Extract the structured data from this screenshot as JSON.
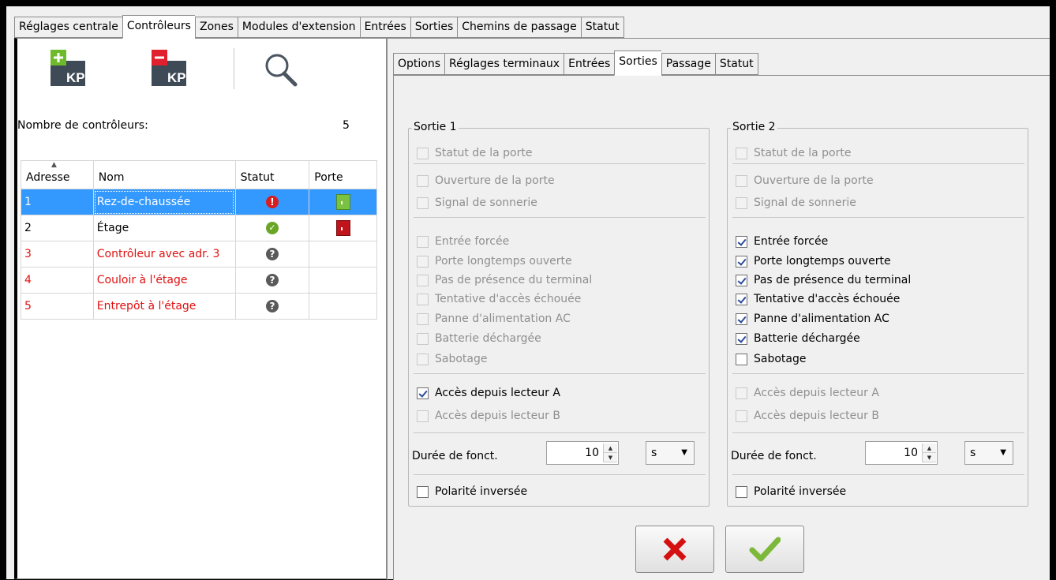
{
  "main_tabs": [
    "Réglages centrale",
    "Contrôleurs",
    "Zones",
    "Modules d'extension",
    "Entrées",
    "Sorties",
    "Chemins de passage",
    "Statut"
  ],
  "main_tab_active": 1,
  "toolbar": {
    "add_label": "KP",
    "remove_label": "KP",
    "icons": [
      "add-keypad-icon",
      "remove-keypad-icon",
      "search-icon"
    ]
  },
  "controllers_count": {
    "label": "Nombre de contrôleurs:",
    "value": "5"
  },
  "table": {
    "headers": [
      "Adresse",
      "Nom",
      "Statut",
      "Porte"
    ],
    "rows": [
      {
        "address": "1",
        "name": "Rez-de-chaussée",
        "status": "error",
        "door": "open",
        "selected": true,
        "red": false
      },
      {
        "address": "2",
        "name": "Étage",
        "status": "ok",
        "door": "closed",
        "selected": false,
        "red": false
      },
      {
        "address": "3",
        "name": "Contrôleur avec adr. 3",
        "status": "unknown",
        "door": "none",
        "selected": false,
        "red": true
      },
      {
        "address": "4",
        "name": "Couloir à l'étage",
        "status": "unknown",
        "door": "none",
        "selected": false,
        "red": true
      },
      {
        "address": "5",
        "name": "Entrepôt à l'étage",
        "status": "unknown",
        "door": "none",
        "selected": false,
        "red": true
      }
    ]
  },
  "sub_tabs": [
    "Options",
    "Réglages terminaux",
    "Entrées",
    "Sorties",
    "Passage",
    "Statut"
  ],
  "sub_tab_active": 3,
  "outputs": [
    {
      "title": "Sortie 1",
      "options": [
        {
          "label": "Statut de la porte",
          "checked": false,
          "enabled": false
        },
        {
          "label": "Ouverture de la porte",
          "checked": false,
          "enabled": false
        },
        {
          "label": "Signal de sonnerie",
          "checked": false,
          "enabled": false
        },
        {
          "label": "Entrée forcée",
          "checked": false,
          "enabled": false
        },
        {
          "label": "Porte longtemps ouverte",
          "checked": false,
          "enabled": false
        },
        {
          "label": "Pas de présence du terminal",
          "checked": false,
          "enabled": false
        },
        {
          "label": "Tentative d'accès échouée",
          "checked": false,
          "enabled": false
        },
        {
          "label": "Panne d'alimentation AC",
          "checked": false,
          "enabled": false
        },
        {
          "label": "Batterie déchargée",
          "checked": false,
          "enabled": false
        },
        {
          "label": "Sabotage",
          "checked": false,
          "enabled": false
        },
        {
          "label": "Accès depuis lecteur A",
          "checked": true,
          "enabled": true
        },
        {
          "label": "Accès depuis lecteur B",
          "checked": false,
          "enabled": false
        }
      ],
      "duration_label": "Durée de fonct.",
      "duration_value": "10",
      "duration_unit": "s",
      "polarity": {
        "label": "Polarité inversée",
        "checked": false,
        "enabled": true
      }
    },
    {
      "title": "Sortie 2",
      "options": [
        {
          "label": "Statut de la porte",
          "checked": false,
          "enabled": false
        },
        {
          "label": "Ouverture de la porte",
          "checked": false,
          "enabled": false
        },
        {
          "label": "Signal de sonnerie",
          "checked": false,
          "enabled": false
        },
        {
          "label": "Entrée forcée",
          "checked": true,
          "enabled": true
        },
        {
          "label": "Porte longtemps ouverte",
          "checked": true,
          "enabled": true
        },
        {
          "label": "Pas de présence du terminal",
          "checked": true,
          "enabled": true
        },
        {
          "label": "Tentative d'accès échouée",
          "checked": true,
          "enabled": true
        },
        {
          "label": "Panne d'alimentation AC",
          "checked": true,
          "enabled": true
        },
        {
          "label": "Batterie déchargée",
          "checked": true,
          "enabled": true
        },
        {
          "label": "Sabotage",
          "checked": false,
          "enabled": true
        },
        {
          "label": "Accès depuis lecteur A",
          "checked": false,
          "enabled": false
        },
        {
          "label": "Accès depuis lecteur B",
          "checked": false,
          "enabled": false
        }
      ],
      "duration_label": "Durée de fonct.",
      "duration_value": "10",
      "duration_unit": "s",
      "polarity": {
        "label": "Polarité inversée",
        "checked": false,
        "enabled": true
      }
    }
  ],
  "actions": {
    "cancel_icon": "cancel-x-icon",
    "confirm_icon": "confirm-check-icon"
  },
  "colors": {
    "selection": "#3399ff",
    "error_text": "#e01010",
    "status_error": "#d81e1e",
    "status_ok": "#6aa626",
    "status_unknown": "#5a5a5a",
    "door_open": "#7cc242",
    "door_closed": "#c0141a",
    "cancel_red": "#d41010",
    "confirm_green": "#7cb83a"
  }
}
